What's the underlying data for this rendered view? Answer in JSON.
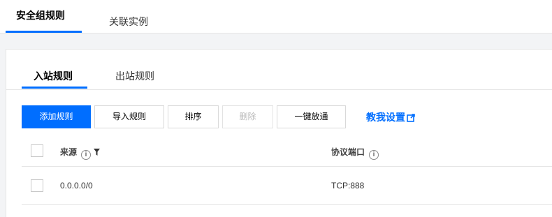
{
  "top_tabs": [
    {
      "label": "安全组规则",
      "active": true
    },
    {
      "label": "关联实例",
      "active": false
    }
  ],
  "sub_tabs": [
    {
      "label": "入站规则",
      "active": true
    },
    {
      "label": "出站规则",
      "active": false
    }
  ],
  "toolbar": {
    "add_label": "添加规则",
    "import_label": "导入规则",
    "sort_label": "排序",
    "delete_label": "删除",
    "open_all_label": "一键放通",
    "help_label": "教我设置"
  },
  "table": {
    "columns": [
      "来源",
      "协议端口"
    ],
    "rows": [
      {
        "source": "0.0.0.0/0",
        "port": "TCP:888"
      }
    ]
  },
  "colors": {
    "accent": "#006eff"
  }
}
